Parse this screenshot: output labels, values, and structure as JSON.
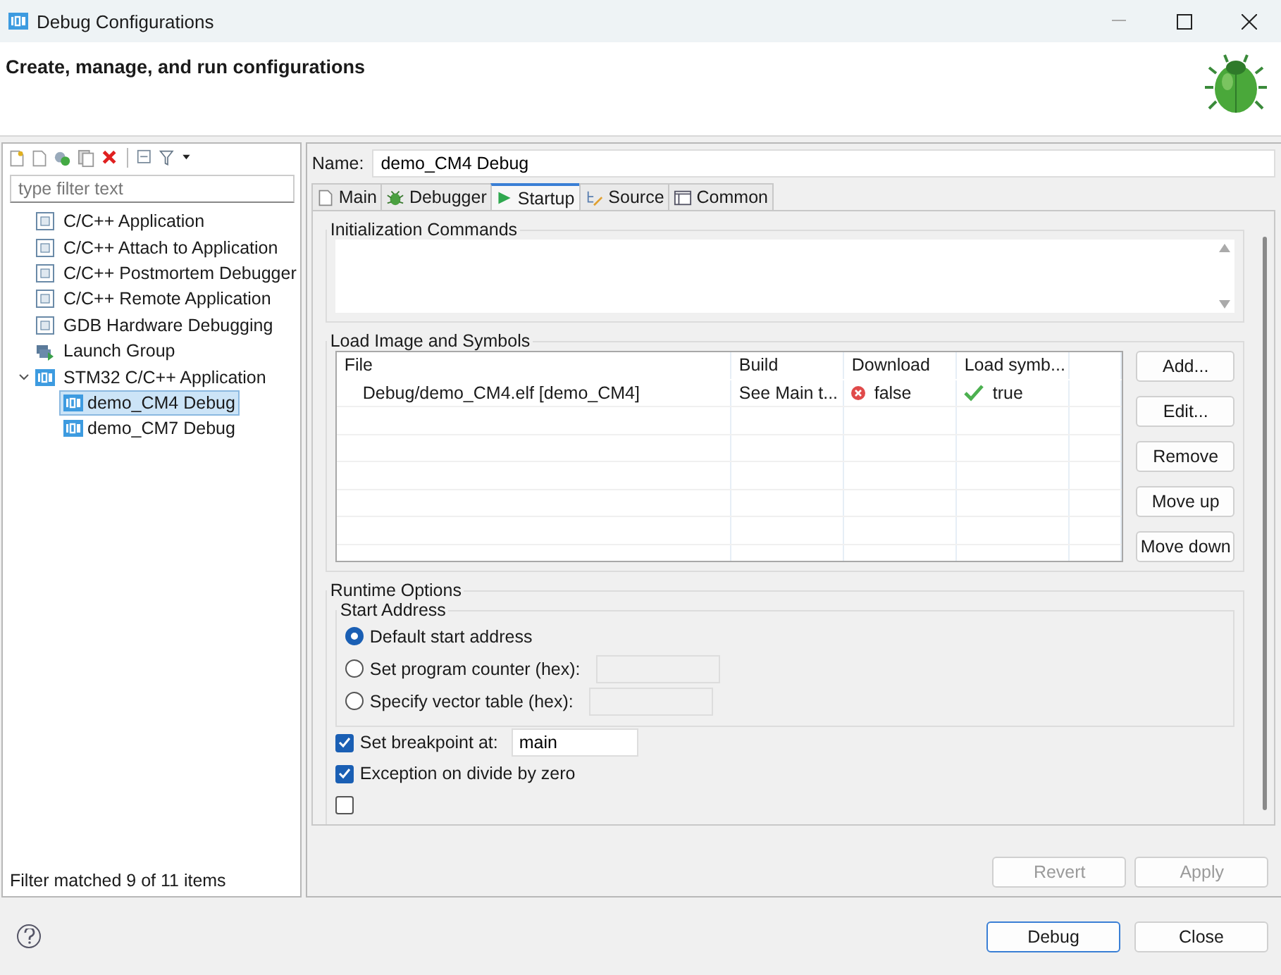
{
  "window": {
    "title": "Debug Configurations"
  },
  "header": {
    "title": "Create, manage, and run configurations"
  },
  "filter": {
    "placeholder": "type filter text"
  },
  "tree": [
    {
      "label": "C/C++ Application",
      "kind": "c",
      "selected": false
    },
    {
      "label": "C/C++ Attach to Application",
      "kind": "c",
      "selected": false
    },
    {
      "label": "C/C++ Postmortem Debugger",
      "kind": "c",
      "selected": false
    },
    {
      "label": "C/C++ Remote Application",
      "kind": "c",
      "selected": false
    },
    {
      "label": "GDB Hardware Debugging",
      "kind": "c",
      "selected": false
    },
    {
      "label": "Launch Group",
      "kind": "launch",
      "selected": false
    },
    {
      "label": "STM32 C/C++ Application",
      "kind": "ide",
      "selected": false,
      "expanded": true,
      "children": [
        {
          "label": "demo_CM4 Debug",
          "kind": "ide",
          "selected": true
        },
        {
          "label": "demo_CM7 Debug",
          "kind": "ide",
          "selected": false
        }
      ]
    }
  ],
  "filter_status": "Filter matched 9 of 11 items",
  "name": {
    "label": "Name:",
    "value": "demo_CM4 Debug"
  },
  "tabs": [
    {
      "label": "Main",
      "kind": "page",
      "selected": false
    },
    {
      "label": "Debugger",
      "kind": "bug",
      "selected": false
    },
    {
      "label": "Startup",
      "kind": "play",
      "selected": true
    },
    {
      "label": "Source",
      "kind": "source",
      "selected": false
    },
    {
      "label": "Common",
      "kind": "common",
      "selected": false
    }
  ],
  "init_commands": {
    "title": "Initialization Commands"
  },
  "load_image": {
    "title": "Load Image and Symbols",
    "columns": [
      "File",
      "Build",
      "Download",
      "Load symb..."
    ],
    "rows": [
      {
        "file": "Debug/demo_CM4.elf [demo_CM4]",
        "build": "See Main t...",
        "download": {
          "text": "false",
          "ok": false
        },
        "load_symbols": {
          "text": "true",
          "ok": true
        }
      }
    ],
    "buttons": [
      "Add...",
      "Edit...",
      "Remove",
      "Move up",
      "Move down"
    ]
  },
  "runtime": {
    "title": "Runtime Options",
    "start_address": {
      "title": "Start Address",
      "options": [
        {
          "label": "Default start address",
          "selected": true,
          "has_field": false
        },
        {
          "label": "Set program counter (hex):",
          "selected": false,
          "has_field": true
        },
        {
          "label": "Specify vector table (hex):",
          "selected": false,
          "has_field": true
        }
      ]
    },
    "checks": [
      {
        "label": "Set breakpoint at:",
        "checked": true,
        "value": "main"
      },
      {
        "label": "Exception on divide by zero",
        "checked": true
      },
      {
        "checked": false
      }
    ]
  },
  "revert": {
    "label": "Revert",
    "disabled": true
  },
  "apply": {
    "label": "Apply",
    "disabled": true
  },
  "dialog_buttons": [
    {
      "label": "Debug",
      "default": true
    },
    {
      "label": "Close",
      "default": false
    }
  ]
}
